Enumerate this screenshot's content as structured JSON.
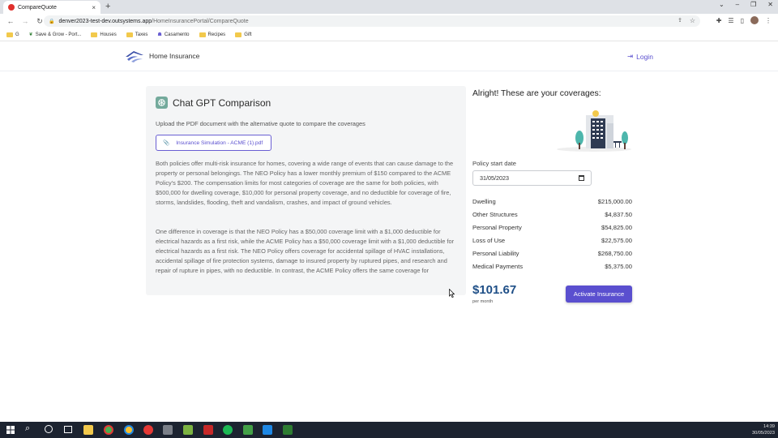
{
  "browser": {
    "tab_title": "CompareQuote",
    "tab_close": "×",
    "new_tab": "+",
    "url_host": "denver2023-test-dev.outsystems.app",
    "url_path": "/HomeInsurancePortal/CompareQuote",
    "bookmarks": [
      "G",
      "Save & Grow - Port...",
      "Houses",
      "Taxes",
      "Casamento",
      "Recipes",
      "Gift"
    ],
    "window_controls": [
      "⌄",
      "–",
      "❐",
      "✕"
    ]
  },
  "app": {
    "brand": "Home Insurance",
    "login_label": "Login"
  },
  "comparison": {
    "title": "Chat GPT Comparison",
    "upload_text": "Upload the PDF document with the alternative quote to compare the coverages",
    "file_name": "Insurance Simulation - ACME (1).pdf",
    "paragraph1": "Both policies offer multi-risk insurance for homes, covering a wide range of events that can cause damage to the property or personal belongings. The NEO Policy has a lower monthly premium of $150 compared to the ACME Policy's $200. The compensation limits for most categories of coverage are the same for both policies, with $500,000 for dwelling coverage, $10,000 for personal property coverage, and no deductible for coverage of fire, storms, landslides, flooding, theft and vandalism, crashes, and impact of ground vehicles.",
    "paragraph2": "One difference in coverage is that the NEO Policy has a $50,000 coverage limit with a $1,000 deductible for electrical hazards as a first risk, while the ACME Policy has a $50,000 coverage limit with a $1,000 deductible for electrical hazards as a first risk. The NEO Policy offers coverage for accidental spillage of HVAC installations, accidental spillage of fire protection systems, damage to insured property by ruptured pipes, and research and repair of rupture in pipes, with no deductible. In contrast, the ACME Policy offers the same coverage for"
  },
  "coverages": {
    "title": "Alright! These are your coverages:",
    "start_date_label": "Policy start date",
    "start_date_value": "31/05/2023",
    "items": [
      {
        "name": "Dwelling",
        "value": "$215,000.00"
      },
      {
        "name": "Other Structures",
        "value": "$4,837.50"
      },
      {
        "name": "Personal Property",
        "value": "$54,825.00"
      },
      {
        "name": "Loss of Use",
        "value": "$22,575.00"
      },
      {
        "name": "Personal Liability",
        "value": "$268,750.00"
      },
      {
        "name": "Medical Payments",
        "value": "$5,375.00"
      }
    ],
    "price": "$101.67",
    "per_month": "per month",
    "activate_label": "Activate Insurance"
  },
  "taskbar": {
    "time": "14:39",
    "date": "30/05/2023"
  },
  "colors": {
    "accent": "#5a4fcf",
    "price": "#1f4f87",
    "panel_bg": "#f4f5f6"
  }
}
